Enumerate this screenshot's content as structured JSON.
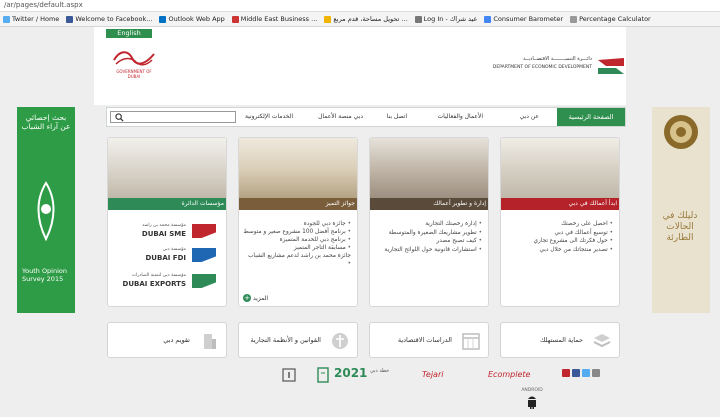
{
  "browser": {
    "address": "/ar/pages/default.aspx",
    "bookmarks": [
      {
        "label": "Twitter / Home",
        "color": "#55acee"
      },
      {
        "label": "Welcome to Facebook...",
        "color": "#3b5998"
      },
      {
        "label": "Outlook Web App",
        "color": "#0072c6"
      },
      {
        "label": "Middle East Business ...",
        "color": "#cc3333"
      },
      {
        "label": "تحويل مساحة، قدم مربع ...",
        "color": "#f0b400"
      },
      {
        "label": "Log In - عيد شراك",
        "color": "#777777"
      },
      {
        "label": "Consumer Barometer",
        "color": "#4285f4"
      },
      {
        "label": "Percentage Calculator",
        "color": "#999999"
      }
    ]
  },
  "header": {
    "english_label": "English",
    "govt_logo_text": "GOVERNMENT OF DUBAI",
    "dept_name_ar": "دائـــرة التنميــــــــة الاقتصــاديــة",
    "dept_name_en": "DEPARTMENT OF ECONOMIC DEVELOPMENT"
  },
  "nav": {
    "home": "الصفحة الرئيسية",
    "items": [
      "عن دبي",
      "الأعمال والفعاليات",
      "اتصل بنا",
      "دبي منصة الأعمال",
      "الخدمات الإلكترونية"
    ]
  },
  "left_banner": {
    "title": "بحث إحصائي عن آراء الشباب",
    "footer": "Youth Opinion Survey 2015"
  },
  "right_banner": {
    "text": "دليلك في الحالات الطارئة"
  },
  "cards": [
    {
      "title": "ابدأ أعمالك في دبي",
      "band_color": "#b5222a",
      "items": [
        "احصل على رخصتك",
        "توسيع أعمالك في دبي",
        "حول فكرتك الى مشروع تجاري",
        "تصدير منتجاتك من خلال دبي"
      ]
    },
    {
      "title": "إدارة و تطوير أعمالك",
      "band_color": "#5a4a3a",
      "items": [
        "إدارة رخصتك التجارية",
        "تطوير مشاريعك الصغيرة والمتوسطة",
        "كيف تصبح مصدر",
        "استشارات قانونية حول اللوائح التجارية"
      ]
    },
    {
      "title": "جوائز التميز",
      "band_color": "#7a5e3c",
      "items": [
        "جائزة دبي للجودة",
        "برنامج أفضل 100 مشروع صغير و متوسط",
        "برنامج دبي للخدمة المتميزة",
        "مسابقة التاجر المتميز",
        "جائزة محمد بن راشد لدعم مشاريع الشباب"
      ],
      "more_label": "المزيد"
    },
    {
      "title": "مؤسسات الدائرة",
      "band_color": "#2e8b57",
      "brands": [
        {
          "ar": "مؤسسة محمد بن راشد",
          "en": "DUBAI SME",
          "color": "#c0262d"
        },
        {
          "ar": "مؤسسة دبي",
          "en": "DUBAI FDI",
          "color": "#1f66b3"
        },
        {
          "ar": "مؤسسة دبي لتنمية الصادرات",
          "en": "DUBAI EXPORTS",
          "color": "#2e8b57"
        }
      ]
    }
  ],
  "tiles": [
    {
      "label": "حماية المستهلك"
    },
    {
      "label": "الدراسات الاقتصادية"
    },
    {
      "label": "القوانين و الأنظمة التجارية"
    },
    {
      "label": "تقويم دبي"
    }
  ],
  "footer": {
    "year_logo": "2021",
    "year_logo_sub": "خطة دبي",
    "logo2": "Tejari",
    "logo3": "Ecomplete",
    "social": [
      "share",
      "facebook",
      "twitter",
      "youtube"
    ],
    "app_label": "ANDROID"
  }
}
